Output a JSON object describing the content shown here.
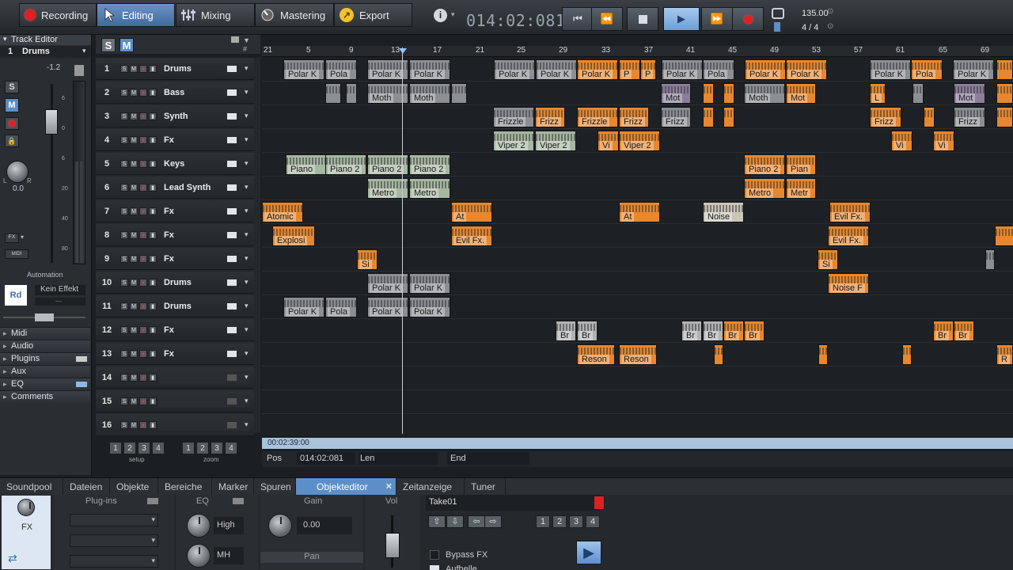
{
  "toolbar": {
    "recording": "Recording",
    "editing": "Editing",
    "mixing": "Mixing",
    "mastering": "Mastering",
    "export": "Export",
    "timecode": "014:02:081",
    "tempo": "135.00",
    "meter": "4 / 4"
  },
  "inspector": {
    "title": "Track Editor",
    "track_number": "1",
    "track_name": "Drums",
    "volume_db": "-1.2",
    "pan_value": "0.0",
    "pan_l": "L",
    "pan_r": "R",
    "solo": "S",
    "mute": "M",
    "fx_label": "FX",
    "midi_label": "MIDI",
    "automation": "Automation",
    "rd": "Rd",
    "kein_effekt": "Kein Effekt",
    "scale": [
      "6",
      "0",
      "6",
      "20",
      "40",
      "80"
    ],
    "sections": [
      "Midi",
      "Audio",
      "Plugins",
      "Aux",
      "EQ",
      "Comments"
    ]
  },
  "trackhead": {
    "solo_all": "S",
    "mute_all": "M",
    "setup": "setup",
    "zoom": "zoom",
    "preset_nums": [
      "1",
      "2",
      "3",
      "4"
    ],
    "tracks": [
      {
        "n": "1",
        "name": "Drums"
      },
      {
        "n": "2",
        "name": "Bass"
      },
      {
        "n": "3",
        "name": "Synth"
      },
      {
        "n": "4",
        "name": "Fx"
      },
      {
        "n": "5",
        "name": "Keys"
      },
      {
        "n": "6",
        "name": "Lead Synth"
      },
      {
        "n": "7",
        "name": "Fx"
      },
      {
        "n": "8",
        "name": "Fx"
      },
      {
        "n": "9",
        "name": "Fx"
      },
      {
        "n": "10",
        "name": "Drums"
      },
      {
        "n": "11",
        "name": "Drums"
      },
      {
        "n": "12",
        "name": "Fx"
      },
      {
        "n": "13",
        "name": "Fx"
      },
      {
        "n": "14",
        "name": ""
      },
      {
        "n": "15",
        "name": ""
      },
      {
        "n": "16",
        "name": ""
      }
    ]
  },
  "ruler": {
    "ticks": [
      "21",
      "5",
      "9",
      "13",
      "17",
      "21",
      "25",
      "29",
      "33",
      "37",
      "41",
      "45",
      "49",
      "53",
      "57",
      "61",
      "65",
      "69"
    ]
  },
  "arranger": {
    "position_label": "00:02:39:00",
    "pos_label": "Pos",
    "pos_value": "014:02:081",
    "len_label": "Len",
    "end_label": "End"
  },
  "bottom_tabs": [
    "Soundpool",
    "Dateien",
    "Objekte",
    "Bereiche",
    "Marker",
    "Spuren",
    "Objekteditor",
    "Zeitanzeige",
    "Tuner"
  ],
  "objekteditor": {
    "fx": "FX",
    "plugins": "Plug-ins",
    "eq": "EQ",
    "gain": "Gain",
    "vol": "Vol",
    "pan": "Pan",
    "gain_value": "0.00",
    "high": "High",
    "mh": "MH",
    "take": "Take01",
    "nums": [
      "1",
      "2",
      "3",
      "4"
    ],
    "bypass": "Bypass FX",
    "aufhellen": "Aufhelle"
  },
  "colors": {
    "accent": "#5c8ec8",
    "clip_orange": "#e8872d",
    "record": "#e02020"
  }
}
